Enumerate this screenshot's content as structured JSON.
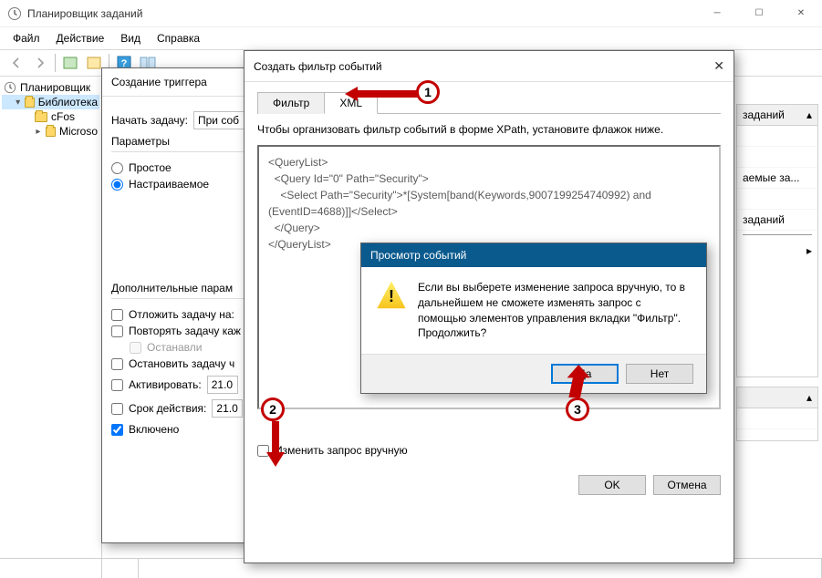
{
  "main_window": {
    "title": "Планировщик заданий",
    "menu": {
      "file": "Файл",
      "action": "Действие",
      "view": "Вид",
      "help": "Справка"
    }
  },
  "tree": {
    "root": "Планировщик",
    "library": "Библиотека",
    "children": [
      "cFos",
      "Microso"
    ]
  },
  "right_panel": {
    "items": [
      "заданий",
      "аемые за...",
      "заданий"
    ]
  },
  "trigger_dialog": {
    "title": "Создание триггера",
    "start_label": "Начать задачу:",
    "start_value": "При соб",
    "params_title": "Параметры",
    "radio_simple": "Простое",
    "radio_custom": "Настраиваемое",
    "extra_title": "Дополнительные парам",
    "chk_delay": "Отложить задачу на:",
    "chk_repeat": "Повторять задачу каж",
    "chk_stopafter_sub": "Останавли",
    "chk_stop": "Остановить задачу ч",
    "chk_activate": "Активировать:",
    "chk_expire": "Срок действия:",
    "date_value": "21.0",
    "chk_enabled": "Включено"
  },
  "filter_dialog": {
    "title": "Создать фильтр событий",
    "tab_filter": "Фильтр",
    "tab_xml": "XML",
    "instruction": "Чтобы организовать фильтр событий в форме XPath, установите флажок ниже.",
    "xml_query": "<QueryList>\n  <Query Id=\"0\" Path=\"Security\">\n    <Select Path=\"Security\">*[System[band(Keywords,9007199254740992) and (EventID=4688)]]</Select>\n  </Query>\n</QueryList>",
    "chk_manual": "Изменить запрос вручную",
    "ok": "OK",
    "cancel": "Отмена"
  },
  "msg_dialog": {
    "title": "Просмотр событий",
    "text": "Если вы выберете изменение запроса вручную, то в дальнейшем не сможете изменять запрос с помощью элементов управления вкладки \"Фильтр\". Продолжить?",
    "yes": "Да",
    "no": "Нет"
  },
  "annotations": {
    "m1": "1",
    "m2": "2",
    "m3": "3"
  }
}
